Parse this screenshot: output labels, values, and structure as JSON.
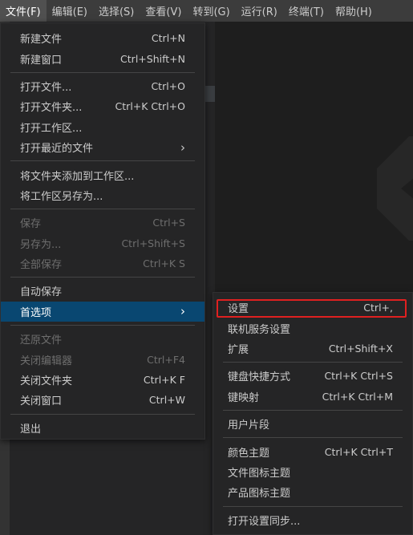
{
  "menubar": [
    {
      "label": "文件(F)",
      "active": true
    },
    {
      "label": "编辑(E)"
    },
    {
      "label": "选择(S)"
    },
    {
      "label": "查看(V)"
    },
    {
      "label": "转到(G)"
    },
    {
      "label": "运行(R)"
    },
    {
      "label": "终端(T)"
    },
    {
      "label": "帮助(H)"
    }
  ],
  "file_menu": {
    "new_file": {
      "label": "新建文件",
      "shortcut": "Ctrl+N"
    },
    "new_window": {
      "label": "新建窗口",
      "shortcut": "Ctrl+Shift+N"
    },
    "open_file": {
      "label": "打开文件...",
      "shortcut": "Ctrl+O"
    },
    "open_folder": {
      "label": "打开文件夹...",
      "shortcut": "Ctrl+K Ctrl+O"
    },
    "open_workspace": {
      "label": "打开工作区..."
    },
    "open_recent": {
      "label": "打开最近的文件",
      "arrow": "›"
    },
    "add_folder": {
      "label": "将文件夹添加到工作区..."
    },
    "save_workspace_as": {
      "label": "将工作区另存为..."
    },
    "save": {
      "label": "保存",
      "shortcut": "Ctrl+S"
    },
    "save_as": {
      "label": "另存为...",
      "shortcut": "Ctrl+Shift+S"
    },
    "save_all": {
      "label": "全部保存",
      "shortcut": "Ctrl+K S"
    },
    "auto_save": {
      "label": "自动保存"
    },
    "preferences": {
      "label": "首选项",
      "arrow": "›"
    },
    "revert_file": {
      "label": "还原文件"
    },
    "close_editor": {
      "label": "关闭编辑器",
      "shortcut": "Ctrl+F4"
    },
    "close_folder": {
      "label": "关闭文件夹",
      "shortcut": "Ctrl+K F"
    },
    "close_window": {
      "label": "关闭窗口",
      "shortcut": "Ctrl+W"
    },
    "exit": {
      "label": "退出"
    }
  },
  "prefs_menu": {
    "settings": {
      "label": "设置",
      "shortcut": "Ctrl+,"
    },
    "online_services": {
      "label": "联机服务设置"
    },
    "extensions": {
      "label": "扩展",
      "shortcut": "Ctrl+Shift+X"
    },
    "keyboard_shortcuts": {
      "label": "键盘快捷方式",
      "shortcut": "Ctrl+K Ctrl+S"
    },
    "keymaps": {
      "label": "键映射",
      "shortcut": "Ctrl+K Ctrl+M"
    },
    "user_snippets": {
      "label": "用户片段"
    },
    "color_theme": {
      "label": "颜色主题",
      "shortcut": "Ctrl+K Ctrl+T"
    },
    "file_icon_theme": {
      "label": "文件图标主题"
    },
    "product_icon_theme": {
      "label": "产品图标主题"
    },
    "settings_sync": {
      "label": "打开设置同步..."
    }
  },
  "colors": {
    "selected": "#094771",
    "highlight_box": "#e02020",
    "menu_bg": "#252526"
  }
}
